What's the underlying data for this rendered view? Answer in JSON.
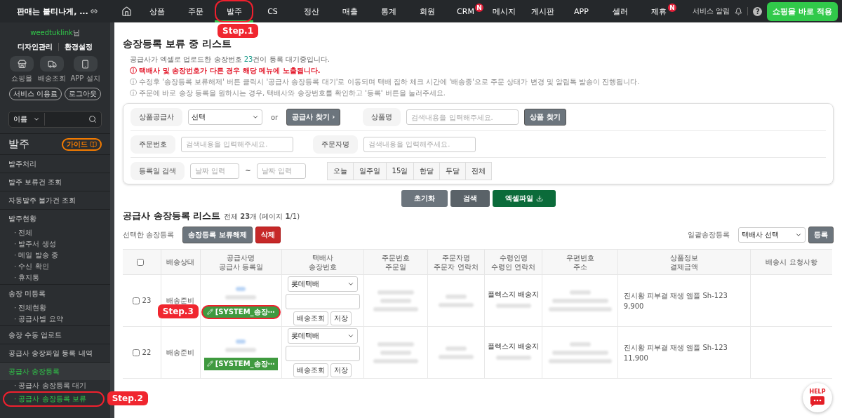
{
  "brand": {
    "title": "판매는 붙티나게, ..."
  },
  "nav": [
    {
      "label": "상품",
      "selected": false
    },
    {
      "label": "주문",
      "selected": false
    },
    {
      "label": "발주",
      "selected": true,
      "callout": "Step.1"
    },
    {
      "label": "CS",
      "selected": false
    },
    {
      "label": "정산",
      "selected": false
    },
    {
      "label": "매출",
      "selected": false
    },
    {
      "label": "통계",
      "selected": false
    },
    {
      "label": "회원",
      "selected": false
    },
    {
      "label": "CRM",
      "selected": false,
      "badge": "N"
    },
    {
      "label": "메시지",
      "selected": false
    },
    {
      "label": "게시판",
      "selected": false
    },
    {
      "label": "APP",
      "selected": false
    },
    {
      "label": "셀러",
      "selected": false
    },
    {
      "label": "제휴",
      "selected": false,
      "badge": "N"
    }
  ],
  "top_right": {
    "alerts": "서비스 알림",
    "help": "?",
    "apply_button": "쇼핑몰 바로 적용"
  },
  "sidebar": {
    "user": "weedtuklink",
    "user_suffix": "님",
    "links": [
      "디자인관리",
      "환경설정"
    ],
    "shortcuts": [
      {
        "kind": "store",
        "label": "쇼핑몰"
      },
      {
        "kind": "truck",
        "label": "배송조회"
      },
      {
        "kind": "phone",
        "label": "APP 설치"
      }
    ],
    "account_buttons": [
      "서비스 이용료",
      "로그아웃"
    ],
    "search": {
      "scope": "이름"
    },
    "section_title": "발주",
    "guide_button": "가이드",
    "items": [
      {
        "label": "발주처리",
        "selected": false
      },
      {
        "label": "발주 보류건 조회",
        "selected": false
      },
      {
        "label": "자동발주 불가건 조회",
        "selected": false
      },
      {
        "label": "발주현황",
        "selected": false,
        "children": [
          {
            "label": "· 전체",
            "selected": false
          },
          {
            "label": "· 발주서 생성",
            "selected": false
          },
          {
            "label": "· 메일 발송 중",
            "selected": false
          },
          {
            "label": "· 수신 확인",
            "selected": false
          },
          {
            "label": "· 휴지통",
            "selected": false
          }
        ]
      },
      {
        "label": "송장 미등록",
        "selected": false,
        "children": [
          {
            "label": "· 전체현황",
            "selected": false
          },
          {
            "label": "· 공급사별 요약",
            "selected": false
          }
        ]
      },
      {
        "label": "송장 수동 업로드",
        "selected": false
      },
      {
        "label": "공급사 송장파일 등록 내역",
        "selected": false
      },
      {
        "label": "공급사 송장등록",
        "selected": true,
        "children": [
          {
            "label": "· 공급사 송장등록 대기",
            "selected": false
          },
          {
            "label": "· 공급사 송장등록 보류",
            "selected": true,
            "callout": "Step.2"
          }
        ]
      }
    ]
  },
  "page": {
    "title": "송장등록 보류 중 리스트",
    "notes": [
      {
        "kind": "plain",
        "text": "공급사가 엑셀로 업로드한 송장번호 **23**건이 등록 대기중입니다."
      },
      {
        "kind": "warning",
        "text": "ⓘ 택배사 및 송장번호가 다른 경우 해당 메뉴에 노출됩니다."
      },
      {
        "kind": "info",
        "text": "ⓘ 수정후 '송장등록 보류해제' 버튼 클릭시 '공급사 송장등록 대기'로 이동되며 택배 집하 체크 시간에 '배송중'으로 주문 상태가 변경 및 알림톡 발송이 진행됩니다."
      },
      {
        "kind": "info",
        "text": "ⓘ 주문에 바로 송장 등록을 원하시는 경우, 택배사와 송장번호를 확인하고 '등록' 버튼을 눌러주세요."
      }
    ]
  },
  "search_form": {
    "supplier_label": "상품공급사",
    "supplier_select": "선택",
    "or": "or",
    "find_supplier": "공급사 찾기 ›",
    "product_label": "상품명",
    "product_placeholder": "검색내용을 입력해주세요.",
    "find_product": "상품 찾기",
    "order_no_label": "주문번호",
    "order_no_placeholder": "검색내용을 입력해주세요.",
    "orderer_label": "주문자명",
    "orderer_placeholder": "검색내용을 입력해주세요.",
    "date_label": "등록일 검색",
    "date_from_placeholder": "날짜 입력",
    "date_sep": "~",
    "date_to_placeholder": "날짜 입력",
    "periods": [
      "오늘",
      "일주일",
      "15일",
      "한달",
      "두달",
      "전체"
    ]
  },
  "form_buttons": {
    "reset": "초기화",
    "search": "검색",
    "excel": "엑셀파일"
  },
  "list": {
    "title": "공급사 송장등록 리스트",
    "summary": "전체 **23**개 (페이지 **1**/1)",
    "selected_label": "선택한 송장등록",
    "release_button": "송장등록 보류해제",
    "delete_button": "삭제",
    "bulk_label": "일괄송장등록",
    "bulk_select": "택배사 선택",
    "bulk_button": "등록",
    "all_checked": false,
    "columns": [
      {
        "kind": "checkbox"
      },
      {
        "lines": [
          "배송상태"
        ]
      },
      {
        "lines": [
          "공급사명",
          "공급사 등록일"
        ]
      },
      {
        "lines": [
          "택배사",
          "송장번호"
        ]
      },
      {
        "lines": [
          "주문번호",
          "주문일"
        ]
      },
      {
        "lines": [
          "주문자명",
          "주문자 연락처"
        ]
      },
      {
        "lines": [
          "수령인명",
          "수령인 연락처"
        ]
      },
      {
        "lines": [
          "우편번호",
          "주소"
        ]
      },
      {
        "lines": [
          "상품정보",
          "결제금액"
        ]
      },
      {
        "lines": [
          "배송시 요청사항"
        ]
      }
    ],
    "rows": [
      {
        "checked": false,
        "number": "23",
        "status": "배송준비",
        "courier": "롯데택배",
        "track_button": "배송조회",
        "save_button": "저장",
        "tag": "[SYSTEM_송장⋯",
        "tag_callout": "Step.3",
        "recipient": "플렉스지 배송지",
        "product": "진시황 피부결 재생 앰플 Sh-123",
        "price": "9,900"
      },
      {
        "checked": false,
        "number": "22",
        "status": "배송준비",
        "courier": "롯데택배",
        "track_button": "배송조회",
        "save_button": "저장",
        "tag": "[SYSTEM_송장⋯",
        "recipient": "플렉스지 배송지",
        "product": "진시황 피부결 재생 앰플 Sh-123",
        "price": "11,900"
      }
    ]
  },
  "help_button": "HELP"
}
